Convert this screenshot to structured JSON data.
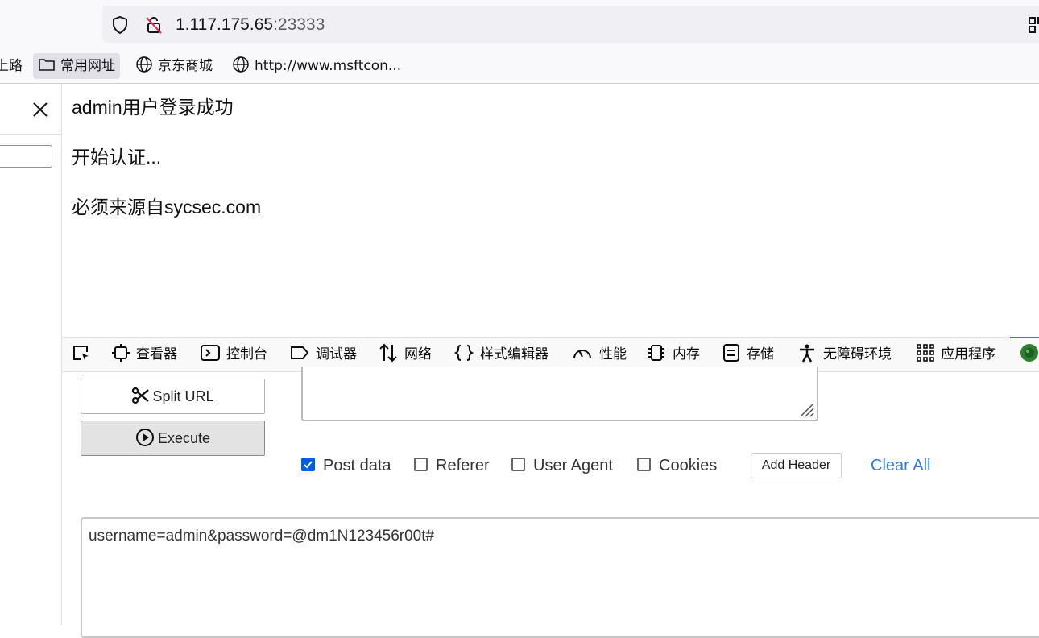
{
  "browser": {
    "url_host": "1.117.175.65",
    "url_port": ":23333",
    "bookmarks": [
      {
        "label": "上路"
      },
      {
        "label": "常用网址"
      },
      {
        "label": "京东商城"
      },
      {
        "label": "http://www.msftcon..."
      }
    ]
  },
  "page": {
    "lines": [
      "admin用户登录成功",
      "开始认证...",
      "必须来源自sycsec.com"
    ]
  },
  "devtools": {
    "tabs": [
      "查看器",
      "控制台",
      "调试器",
      "网络",
      "样式编辑器",
      "性能",
      "内存",
      "存储",
      "无障碍环境",
      "应用程序"
    ]
  },
  "hackbar": {
    "split_label": "Split URL",
    "execute_label": "Execute",
    "checks": [
      {
        "label": "Post data",
        "checked": true
      },
      {
        "label": "Referer",
        "checked": false
      },
      {
        "label": "User Agent",
        "checked": false
      },
      {
        "label": "Cookies",
        "checked": false
      }
    ],
    "add_header_label": "Add Header",
    "clear_all_label": "Clear All",
    "post_body": "username=admin&password=@dm1N123456r00t#"
  },
  "colors": {
    "accent": "#0060df",
    "link": "#2a7fd4",
    "devtools_active": "#0a84ff"
  }
}
